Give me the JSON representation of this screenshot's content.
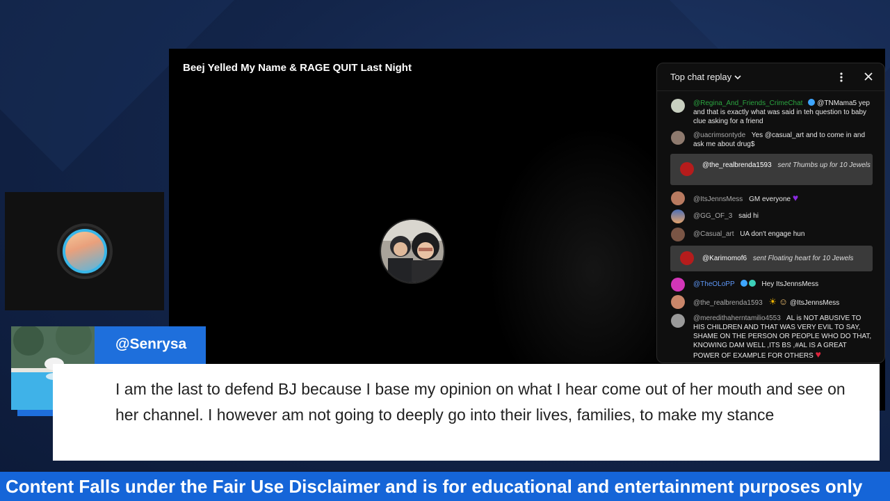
{
  "video": {
    "title": "Beej Yelled My Name & RAGE QUIT Last Night"
  },
  "chat": {
    "title": "Top chat replay",
    "messages": [
      {
        "author": "@Regina_And_Friends_CrimeChat",
        "text": "@TNMama5 yep and that is exactly what was said in teh question to baby clue asking for a friend"
      },
      {
        "author": "@uacrimsontyde",
        "text": "Yes @casual_art and to come in and ask me about drug$"
      },
      {
        "author": "@ItsJennsMess",
        "text": "GM everyone"
      },
      {
        "author": "@GG_OF_3",
        "text": "said hi"
      },
      {
        "author": "@Casual_art",
        "text": "UA don't engage hun"
      },
      {
        "author": "@TheOLoPP",
        "text": "Hey ItsJennsMess"
      },
      {
        "author": "@the_realbrenda1593",
        "text": "@ItsJennsMess"
      },
      {
        "author": "@meredithaherntamilio4553",
        "text": "AL is NOT ABUSIVE TO HIS CHILDREN AND THAT WAS VERY EVIL TO SAY, SHAME ON THE PERSON OR PEOPLE WHO DO THAT, KNOWING DAM WELL ,ITS BS ,#AL IS A GREAT POWER OF EXAMPLE FOR OTHERS"
      }
    ],
    "gifts": [
      {
        "author": "@the_realbrenda1593",
        "text": "sent Thumbs up for 10 Jewels"
      },
      {
        "author": "@Karimomof6",
        "text": "sent Floating heart for 10 Jewels"
      }
    ]
  },
  "comment": {
    "username": "@Senrysa",
    "text": "I am the last to defend BJ because I base my opinion on what I hear come out of her mouth and see on her channel. I however am not going to deeply go into their lives, families, to make my stance"
  },
  "footer": {
    "disclaimer": "Content Falls under the Fair Use Disclaimer and is for educational and entertainment purposes only"
  },
  "icons": {
    "caret": "chevron-down-icon",
    "menu": "more-vert-icon",
    "close": "close-icon",
    "youtube": "youtube-icon"
  },
  "colors": {
    "accent": "#1e6fdc",
    "chat_bg": "#0f0f0f",
    "gift_bg": "#3a3a3a"
  }
}
